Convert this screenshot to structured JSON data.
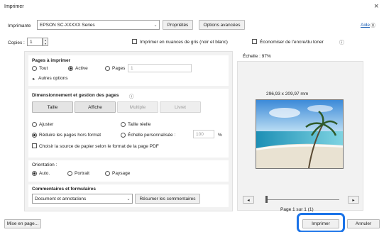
{
  "window": {
    "title": "Imprimer",
    "close_glyph": "×"
  },
  "printer": {
    "label": "Imprimante",
    "value": "EPSON SC-XXXXX Series",
    "properties": "Propriétés",
    "advanced": "Options avancées",
    "help": "Aide",
    "help_glyph": "⓪"
  },
  "copies": {
    "label": "Copies :",
    "value": "1",
    "grayscale": "Imprimer en nuances de gris (noir et blanc)",
    "save_ink": "Économiser de l'encre/du toner",
    "info_glyph": "ⓘ"
  },
  "pages": {
    "title": "Pages à imprimer",
    "all": "Tout",
    "active": "Active",
    "pages": "Pages",
    "pages_value": "1",
    "more": "Autres options",
    "more_glyph": "▸"
  },
  "sizing": {
    "title": "Dimensionnement et gestion des pages",
    "info_glyph": "ⓘ",
    "tabs": [
      "Taille",
      "Affiche",
      "Multiple",
      "Livret"
    ],
    "fit": "Ajuster",
    "actual": "Taille réelle",
    "shrink": "Réduire les pages hors format",
    "custom": "Échelle personnalisée :",
    "custom_value": "100",
    "percent": "%",
    "paper_source": "Choisir la source de papier selon le format de la page PDF"
  },
  "orientation": {
    "title": "Orientation :",
    "auto": "Auto.",
    "portrait": "Portrait",
    "landscape": "Paysage"
  },
  "comments": {
    "title": "Commentaires et formulaires",
    "value": "Document et annotations",
    "summarize": "Résumer les commentaires"
  },
  "preview": {
    "scale": "Échelle : 97%",
    "dimensions": "296,93 x 209,97 mm",
    "page": "Page 1 sur 1 (1)",
    "prev": "◂",
    "next": "▸",
    "slider_fraction": 0.0
  },
  "footer": {
    "page_setup": "Mise en page...",
    "print": "Imprimer",
    "cancel": "Annuler"
  },
  "colors": {
    "highlight": "#1a73e8"
  }
}
